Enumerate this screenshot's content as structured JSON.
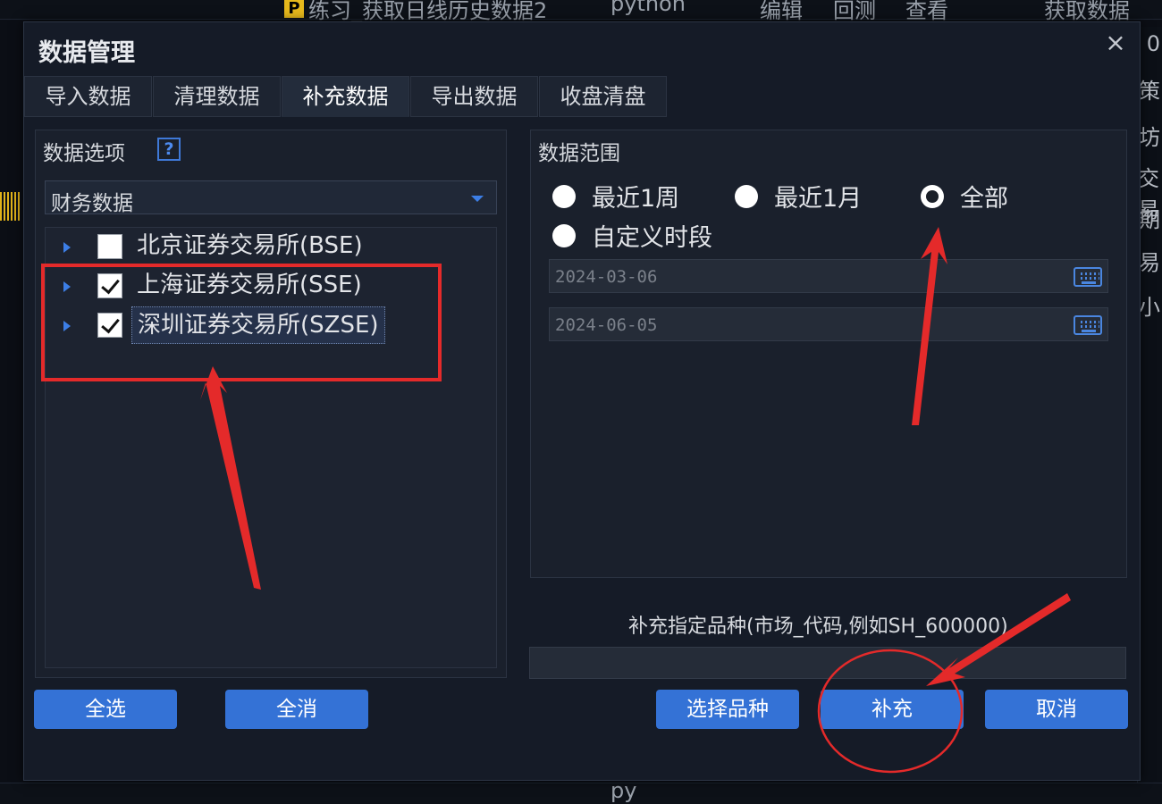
{
  "background": {
    "top_item": "练习_获取日线历史数据2",
    "top_lang": "python",
    "top_edit": "编辑",
    "top_backtest": "回测",
    "top_view": "查看",
    "top_right": "获取数据",
    "right_chars": [
      "0",
      "策",
      "坊",
      "交易",
      "期",
      "易",
      "小"
    ],
    "bottom_lang": "py"
  },
  "dialog": {
    "title": "数据管理",
    "close": "×",
    "tabs": [
      "导入数据",
      "清理数据",
      "补充数据",
      "导出数据",
      "收盘清盘"
    ],
    "active_tab": 2
  },
  "left_panel": {
    "title": "数据选项",
    "help": "?",
    "select_value": "财务数据",
    "exchanges": [
      {
        "label": "北京证券交易所(BSE)",
        "checked": false
      },
      {
        "label": "上海证券交易所(SSE)",
        "checked": true
      },
      {
        "label": "深圳证券交易所(SZSE)",
        "checked": true
      }
    ],
    "select_all": "全选",
    "deselect_all": "全消"
  },
  "right_panel": {
    "title": "数据范围",
    "options": [
      "最近1周",
      "最近1月",
      "全部",
      "自定义时段"
    ],
    "selected_option": "全部",
    "start_date": "2024-03-06",
    "end_date": "2024-06-05",
    "hint": "补充指定品种(市场_代码,例如SH_600000)",
    "code_value": ""
  },
  "buttons": {
    "choose_symbol": "选择品种",
    "supplement": "补充",
    "cancel": "取消"
  },
  "colors": {
    "accent": "#3472d6",
    "annotation": "#e42a2a"
  }
}
